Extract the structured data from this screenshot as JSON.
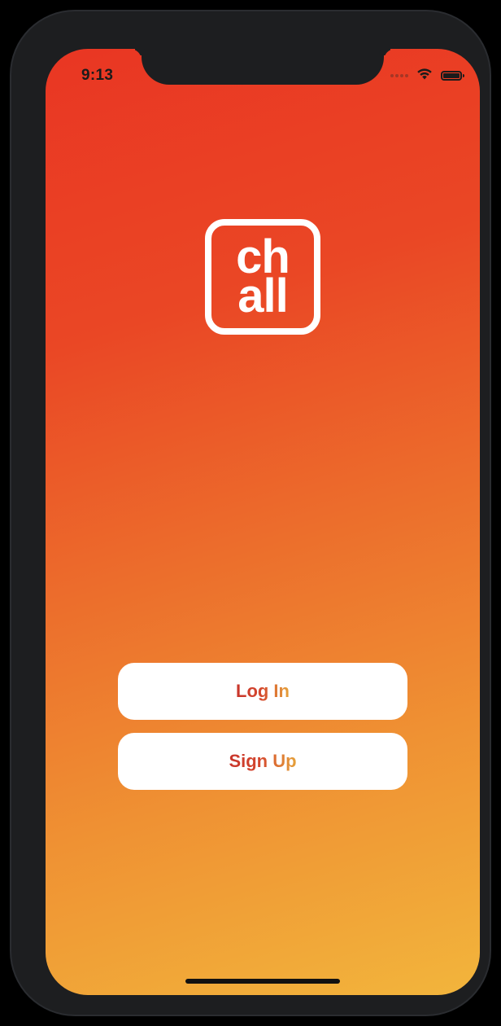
{
  "status_bar": {
    "time": "9:13",
    "icons": [
      "cellular-signal-icon",
      "wifi-icon",
      "battery-icon"
    ]
  },
  "logo": {
    "line1": "ch",
    "line2": "all"
  },
  "actions": {
    "login_label": "Log In",
    "signup_label": "Sign Up"
  },
  "colors": {
    "gradient_top": "#e93623",
    "gradient_bottom": "#f2b53c",
    "button_bg": "#ffffff",
    "button_text_start": "#c8352b",
    "button_text_end": "#e6a33a",
    "device_frame": "#1d1e20"
  }
}
